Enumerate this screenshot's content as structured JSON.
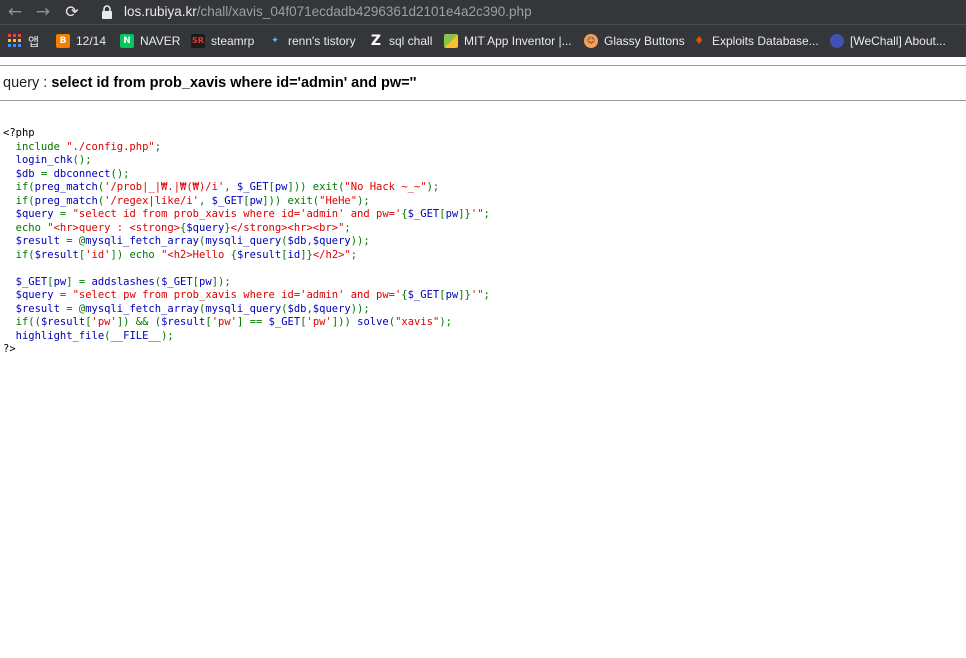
{
  "browser": {
    "back_icon": "arrow-left-icon",
    "forward_icon": "arrow-right-icon",
    "reload_icon": "reload-icon",
    "url_host": "los.rubiya.kr",
    "url_path": "/chall/xavis_04f071ecdadb4296361d2101e4a2c390.php"
  },
  "bookmarks": [
    {
      "label": "앱",
      "icon": "apps-grid-icon",
      "color": "#e8eaed"
    },
    {
      "label": "12/14",
      "icon": "blogger-icon",
      "color": "#f57d00"
    },
    {
      "label": "NAVER",
      "icon": "naver-icon",
      "color": "#03c75a"
    },
    {
      "label": "steamrp",
      "icon": "steamrp-icon",
      "color": "#c62828"
    },
    {
      "label": "renn's tistory",
      "icon": "tistory-icon",
      "color": "#4fc3f7"
    },
    {
      "label": "sql chall",
      "icon": "z-icon",
      "color": "#ffffff"
    },
    {
      "label": "MIT App Inventor |...",
      "icon": "app-inventor-icon",
      "color": "#8bc34a"
    },
    {
      "label": "Glassy Buttons",
      "icon": "glassy-buttons-icon",
      "color": "#f4a261"
    },
    {
      "label": "Exploits Database...",
      "icon": "exploit-db-icon",
      "color": "#e65100"
    },
    {
      "label": "[WeChall] About...",
      "icon": "wechall-icon",
      "color": "#3f51b5"
    }
  ],
  "query": {
    "label": "query : ",
    "sql": "select id from prob_xavis where id='admin' and pw=''"
  },
  "code_lines": [
    [
      {
        "t": "<?php",
        "c": "html"
      }
    ],
    [
      {
        "t": "  include ",
        "c": "keyword"
      },
      {
        "t": "\"./config.php\"",
        "c": "string"
      },
      {
        "t": ";",
        "c": "keyword"
      }
    ],
    [
      {
        "t": "  login_chk",
        "c": "default"
      },
      {
        "t": "();",
        "c": "keyword"
      }
    ],
    [
      {
        "t": "  $db ",
        "c": "default"
      },
      {
        "t": "= ",
        "c": "keyword"
      },
      {
        "t": "dbconnect",
        "c": "default"
      },
      {
        "t": "();",
        "c": "keyword"
      }
    ],
    [
      {
        "t": "  if(",
        "c": "keyword"
      },
      {
        "t": "preg_match",
        "c": "default"
      },
      {
        "t": "(",
        "c": "keyword"
      },
      {
        "t": "'/prob|_|₩.|₩(₩)/i'",
        "c": "string"
      },
      {
        "t": ", ",
        "c": "keyword"
      },
      {
        "t": "$_GET",
        "c": "default"
      },
      {
        "t": "[",
        "c": "keyword"
      },
      {
        "t": "pw",
        "c": "default"
      },
      {
        "t": "])) exit(",
        "c": "keyword"
      },
      {
        "t": "\"No Hack ~_~\"",
        "c": "string"
      },
      {
        "t": ");",
        "c": "keyword"
      }
    ],
    [
      {
        "t": "  if(",
        "c": "keyword"
      },
      {
        "t": "preg_match",
        "c": "default"
      },
      {
        "t": "(",
        "c": "keyword"
      },
      {
        "t": "'/regex|like/i'",
        "c": "string"
      },
      {
        "t": ", ",
        "c": "keyword"
      },
      {
        "t": "$_GET",
        "c": "default"
      },
      {
        "t": "[",
        "c": "keyword"
      },
      {
        "t": "pw",
        "c": "default"
      },
      {
        "t": "])) exit(",
        "c": "keyword"
      },
      {
        "t": "\"HeHe\"",
        "c": "string"
      },
      {
        "t": ");",
        "c": "keyword"
      }
    ],
    [
      {
        "t": "  $query ",
        "c": "default"
      },
      {
        "t": "= ",
        "c": "keyword"
      },
      {
        "t": "\"select id from prob_xavis where id='admin' and pw='",
        "c": "string"
      },
      {
        "t": "{",
        "c": "keyword"
      },
      {
        "t": "$_GET",
        "c": "default"
      },
      {
        "t": "[",
        "c": "keyword"
      },
      {
        "t": "pw",
        "c": "default"
      },
      {
        "t": "]}",
        "c": "keyword"
      },
      {
        "t": "'\"",
        "c": "string"
      },
      {
        "t": ";",
        "c": "keyword"
      }
    ],
    [
      {
        "t": "  echo ",
        "c": "keyword"
      },
      {
        "t": "\"<hr>query : <strong>",
        "c": "string"
      },
      {
        "t": "{",
        "c": "keyword"
      },
      {
        "t": "$query",
        "c": "default"
      },
      {
        "t": "}",
        "c": "keyword"
      },
      {
        "t": "</strong><hr><br>\"",
        "c": "string"
      },
      {
        "t": ";",
        "c": "keyword"
      }
    ],
    [
      {
        "t": "  $result ",
        "c": "default"
      },
      {
        "t": "= @",
        "c": "keyword"
      },
      {
        "t": "mysqli_fetch_array",
        "c": "default"
      },
      {
        "t": "(",
        "c": "keyword"
      },
      {
        "t": "mysqli_query",
        "c": "default"
      },
      {
        "t": "(",
        "c": "keyword"
      },
      {
        "t": "$db",
        "c": "default"
      },
      {
        "t": ",",
        "c": "keyword"
      },
      {
        "t": "$query",
        "c": "default"
      },
      {
        "t": "));",
        "c": "keyword"
      }
    ],
    [
      {
        "t": "  if(",
        "c": "keyword"
      },
      {
        "t": "$result",
        "c": "default"
      },
      {
        "t": "[",
        "c": "keyword"
      },
      {
        "t": "'id'",
        "c": "string"
      },
      {
        "t": "]) echo ",
        "c": "keyword"
      },
      {
        "t": "\"<h2>Hello ",
        "c": "string"
      },
      {
        "t": "{",
        "c": "keyword"
      },
      {
        "t": "$result",
        "c": "default"
      },
      {
        "t": "[",
        "c": "keyword"
      },
      {
        "t": "id",
        "c": "default"
      },
      {
        "t": "]}",
        "c": "keyword"
      },
      {
        "t": "</h2>\"",
        "c": "string"
      },
      {
        "t": ";",
        "c": "keyword"
      }
    ],
    [
      {
        "t": "",
        "c": "default"
      }
    ],
    [
      {
        "t": "  $_GET",
        "c": "default"
      },
      {
        "t": "[",
        "c": "keyword"
      },
      {
        "t": "pw",
        "c": "default"
      },
      {
        "t": "] = ",
        "c": "keyword"
      },
      {
        "t": "addslashes",
        "c": "default"
      },
      {
        "t": "(",
        "c": "keyword"
      },
      {
        "t": "$_GET",
        "c": "default"
      },
      {
        "t": "[",
        "c": "keyword"
      },
      {
        "t": "pw",
        "c": "default"
      },
      {
        "t": "]);",
        "c": "keyword"
      }
    ],
    [
      {
        "t": "  $query ",
        "c": "default"
      },
      {
        "t": "= ",
        "c": "keyword"
      },
      {
        "t": "\"select pw from prob_xavis where id='admin' and pw='",
        "c": "string"
      },
      {
        "t": "{",
        "c": "keyword"
      },
      {
        "t": "$_GET",
        "c": "default"
      },
      {
        "t": "[",
        "c": "keyword"
      },
      {
        "t": "pw",
        "c": "default"
      },
      {
        "t": "]}",
        "c": "keyword"
      },
      {
        "t": "'\"",
        "c": "string"
      },
      {
        "t": ";",
        "c": "keyword"
      }
    ],
    [
      {
        "t": "  $result ",
        "c": "default"
      },
      {
        "t": "= @",
        "c": "keyword"
      },
      {
        "t": "mysqli_fetch_array",
        "c": "default"
      },
      {
        "t": "(",
        "c": "keyword"
      },
      {
        "t": "mysqli_query",
        "c": "default"
      },
      {
        "t": "(",
        "c": "keyword"
      },
      {
        "t": "$db",
        "c": "default"
      },
      {
        "t": ",",
        "c": "keyword"
      },
      {
        "t": "$query",
        "c": "default"
      },
      {
        "t": "));",
        "c": "keyword"
      }
    ],
    [
      {
        "t": "  if((",
        "c": "keyword"
      },
      {
        "t": "$result",
        "c": "default"
      },
      {
        "t": "[",
        "c": "keyword"
      },
      {
        "t": "'pw'",
        "c": "string"
      },
      {
        "t": "]) && (",
        "c": "keyword"
      },
      {
        "t": "$result",
        "c": "default"
      },
      {
        "t": "[",
        "c": "keyword"
      },
      {
        "t": "'pw'",
        "c": "string"
      },
      {
        "t": "] == ",
        "c": "keyword"
      },
      {
        "t": "$_GET",
        "c": "default"
      },
      {
        "t": "[",
        "c": "keyword"
      },
      {
        "t": "'pw'",
        "c": "string"
      },
      {
        "t": "])) ",
        "c": "keyword"
      },
      {
        "t": "solve",
        "c": "default"
      },
      {
        "t": "(",
        "c": "keyword"
      },
      {
        "t": "\"xavis\"",
        "c": "string"
      },
      {
        "t": ");",
        "c": "keyword"
      }
    ],
    [
      {
        "t": "  highlight_file",
        "c": "default"
      },
      {
        "t": "(",
        "c": "keyword"
      },
      {
        "t": "__FILE__",
        "c": "default"
      },
      {
        "t": ");",
        "c": "keyword"
      }
    ],
    [
      {
        "t": "?>",
        "c": "html"
      }
    ]
  ]
}
